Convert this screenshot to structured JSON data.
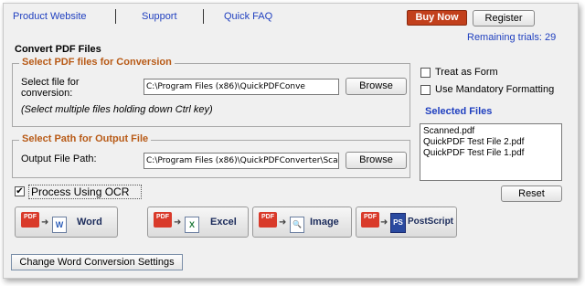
{
  "nav": {
    "product_website": "Product Website",
    "support": "Support",
    "quick_faq": "Quick FAQ",
    "buy_now": "Buy Now",
    "register": "Register",
    "remaining_trials": "Remaining trials: 29"
  },
  "convert": {
    "title": "Convert PDF Files",
    "select_group": {
      "legend": "Select PDF files for Conversion",
      "label": "Select file for conversion:",
      "value": "C:\\Program Files (x86)\\QuickPDFConve",
      "browse": "Browse",
      "hint": "(Select multiple files holding down Ctrl key)"
    },
    "output_group": {
      "legend": "Select Path for Output File",
      "label": "Output File Path:",
      "value": "C:\\Program Files (x86)\\QuickPDFConverter\\Sca",
      "browse": "Browse"
    },
    "treat_as_form": "Treat as Form",
    "mandatory_formatting": "Use Mandatory Formatting",
    "selected_files_title": "Selected Files",
    "selected_files": [
      "Scanned.pdf",
      "QuickPDF Test File 2.pdf",
      "QuickPDF Test File 1.pdf"
    ],
    "reset": "Reset",
    "ocr_label": "Process Using OCR",
    "ocr_checked": true
  },
  "conversions": [
    {
      "label": "Word",
      "icon_text": "W",
      "icon_color": "#2b5cb8"
    },
    {
      "label": "Excel",
      "icon_text": "X",
      "icon_color": "#1f7a3a"
    },
    {
      "label": "Image",
      "icon_text": "🔍",
      "icon_color": "#3a6a9a"
    },
    {
      "label": "PostScript",
      "icon_text": "PS",
      "icon_color": "#2a4aa0"
    }
  ],
  "icons": {
    "pdf": "PDF",
    "arrow": "➜",
    "check": "✔"
  },
  "settings_button": "Change Word Conversion Settings",
  "colors": {
    "accent_link": "#1f3fbf",
    "buy_now_bg": "#c2401c",
    "group_legend": "#b85a16"
  }
}
